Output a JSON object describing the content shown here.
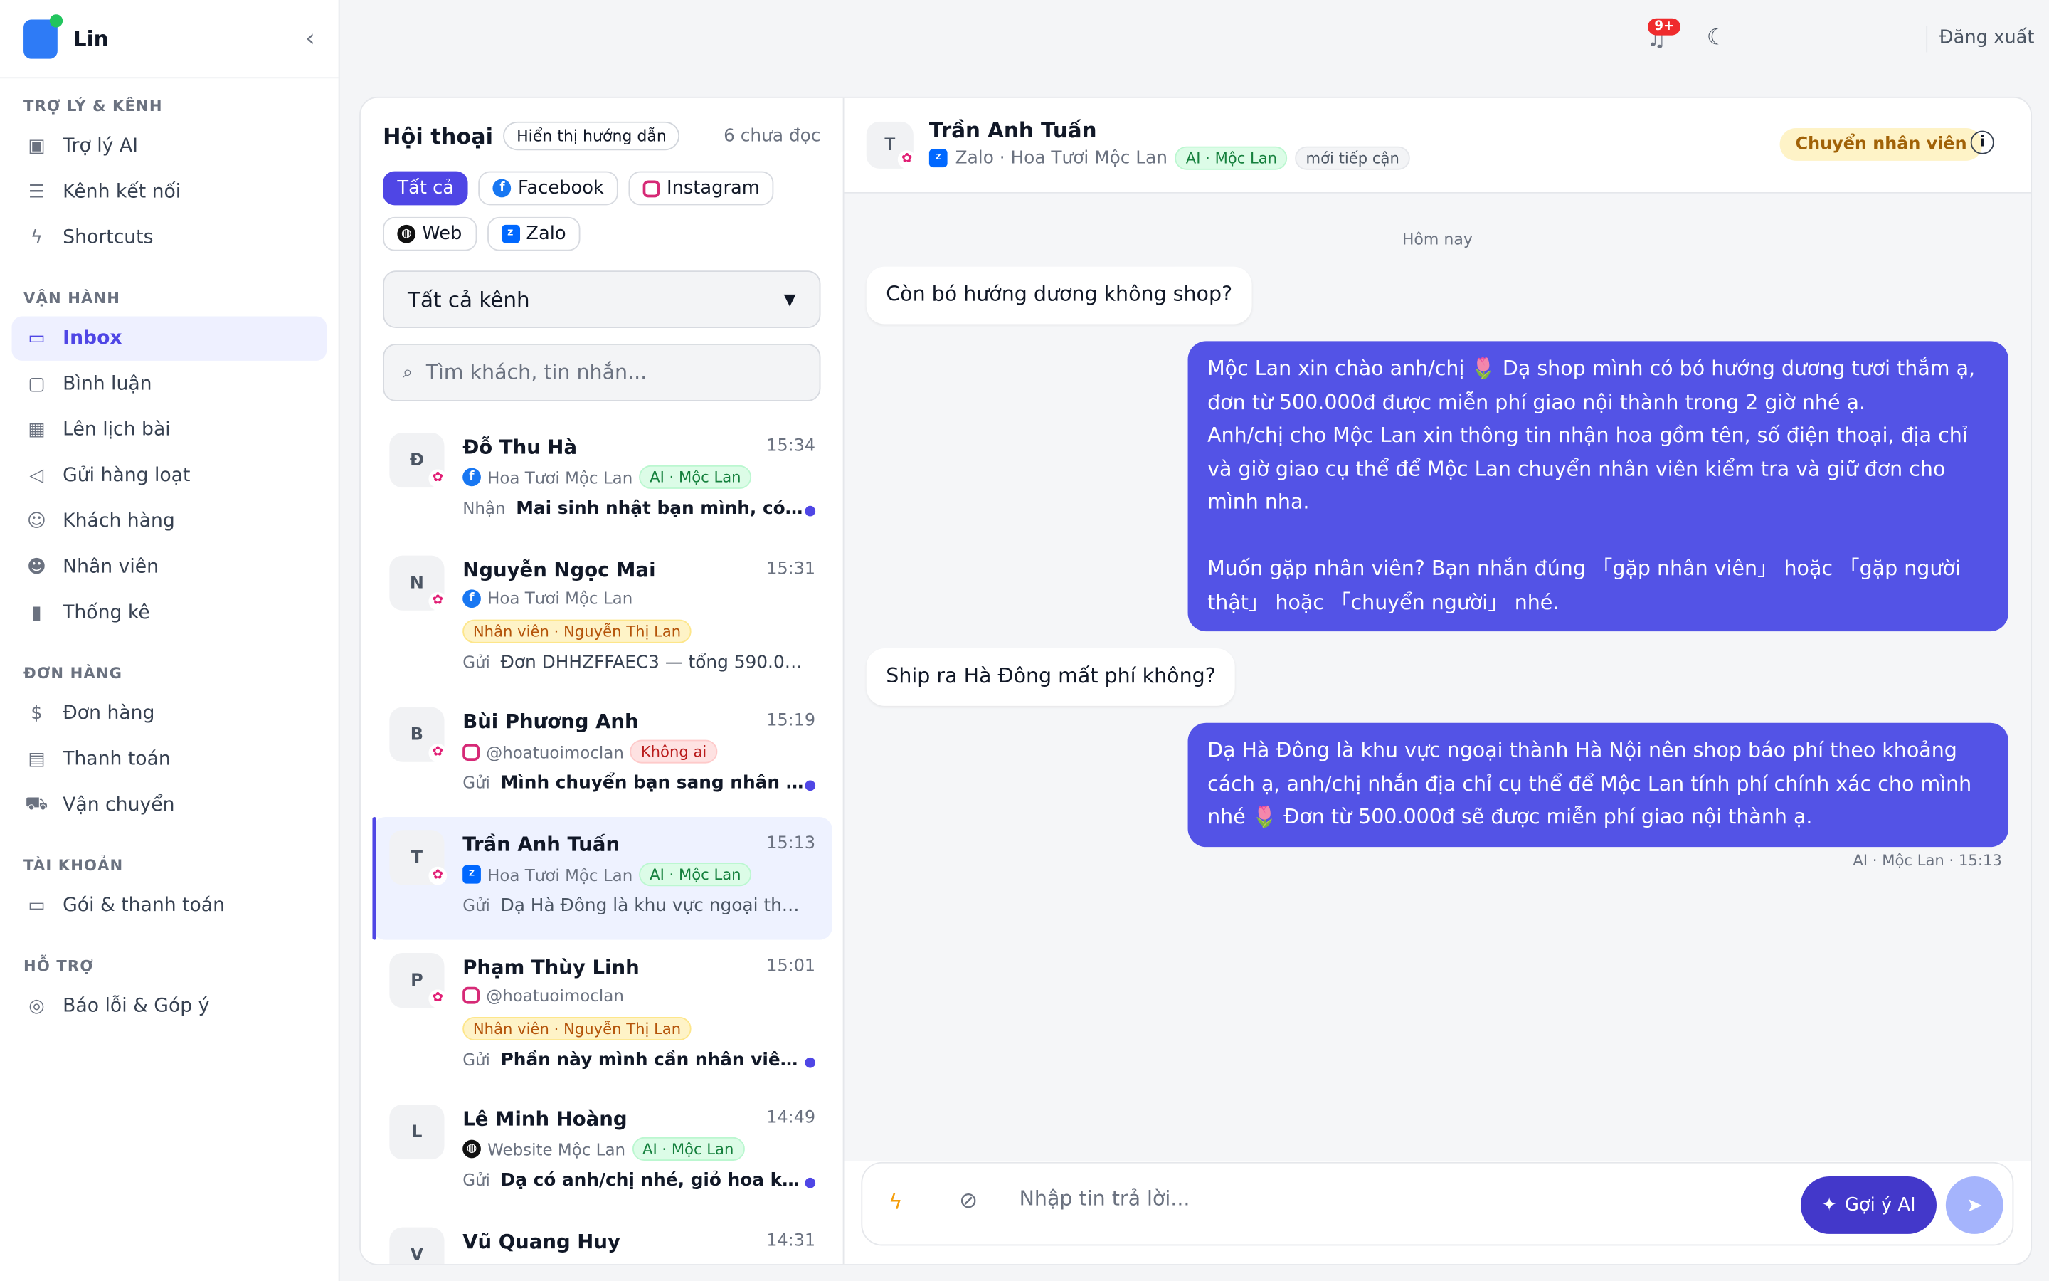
{
  "brand": {
    "name": "Lin"
  },
  "sidebar": {
    "sections": [
      {
        "title": "TRỢ LÝ & KÊNH",
        "items": [
          "Trợ lý AI",
          "Kênh kết nối",
          "Shortcuts"
        ]
      },
      {
        "title": "VẬN HÀNH",
        "items": [
          "Inbox",
          "Bình luận",
          "Lên lịch bài",
          "Gửi hàng loạt",
          "Khách hàng",
          "Nhân viên",
          "Thống kê"
        ]
      },
      {
        "title": "ĐƠN HÀNG",
        "items": [
          "Đơn hàng",
          "Thanh toán",
          "Vận chuyển"
        ]
      },
      {
        "title": "TÀI KHOẢN",
        "items": [
          "Gói & thanh toán"
        ]
      },
      {
        "title": "HỖ TRỢ",
        "items": [
          "Báo lỗi & Góp ý"
        ]
      }
    ]
  },
  "topbar": {
    "badge": "9+",
    "logout": "Đăng xuất"
  },
  "conv": {
    "title": "Hội thoại",
    "guide": "Hiển thị hướng dẫn",
    "unread": "6 chưa đọc",
    "chips": [
      "Tất cả",
      "Facebook",
      "Instagram",
      "Web",
      "Zalo"
    ],
    "select": "Tất cả kênh",
    "search_placeholder": "Tìm khách, tin nhắn...",
    "rows": [
      {
        "initial": "Đ",
        "name": "Đỗ Thu Hà",
        "time": "15:34",
        "channel": "Hoa Tươi Mộc Lan",
        "tag": "AI · Mộc Lan",
        "dir": "Nhận",
        "preview": "Mai sinh nhật bạn mình, có mẫ..."
      },
      {
        "initial": "N",
        "name": "Nguyễn Ngọc Mai",
        "time": "15:31",
        "channel": "Hoa Tươi Mộc Lan",
        "tag": "Nhân viên · Nguyễn Thị Lan",
        "dir": "Gửi",
        "preview": "Đơn DHHZFFAEC3 — tổng 590.00..."
      },
      {
        "initial": "B",
        "name": "Bùi Phương Anh",
        "time": "15:19",
        "channel": "@hoatuoimoclan",
        "tag": "Không ai",
        "dir": "Gửi",
        "preview": "Mình chuyển bạn sang nhân viên..."
      },
      {
        "initial": "T",
        "name": "Trần Anh Tuấn",
        "time": "15:13",
        "channel": "Hoa Tươi Mộc Lan",
        "tag": "AI · Mộc Lan",
        "dir": "Gửi",
        "preview": "Dạ Hà Đông là khu vực ngoại thành..."
      },
      {
        "initial": "P",
        "name": "Phạm Thùy Linh",
        "time": "15:01",
        "channel": "@hoatuoimoclan",
        "tag": "Nhân viên · Nguyễn Thị Lan",
        "dir": "Gửi",
        "preview": "Phần này mình cần nhân viên kiể..."
      },
      {
        "initial": "L",
        "name": "Lê Minh Hoàng",
        "time": "14:49",
        "channel": "Website Mộc Lan",
        "tag": "AI · Mộc Lan",
        "dir": "Gửi",
        "preview": "Dạ có anh/chị nhé, giỏ hoa khai ..."
      },
      {
        "initial": "V",
        "name": "Vũ Quang Huy",
        "time": "14:31"
      }
    ]
  },
  "chat": {
    "initial": "T",
    "name": "Trần Anh Tuấn",
    "channel": "Zalo · Hoa Tươi Mộc Lan",
    "tag_ai": "AI · Mộc Lan",
    "tag_new": "mới tiếp cận",
    "transfer": "Chuyển nhân viên",
    "day": "Hôm nay",
    "messages": [
      "Còn bó hướng dương không shop?",
      "Mộc Lan xin chào anh/chị 🌷 Dạ shop mình có bó hướng dương tươi thắm ạ, đơn từ 500.000đ được miễn phí giao nội thành trong 2 giờ nhé ạ.\nAnh/chị cho Mộc Lan xin thông tin nhận hoa gồm tên, số điện thoại, địa chỉ và giờ giao cụ thể để Mộc Lan chuyển nhân viên kiểm tra và giữ đơn cho mình nha.\n\nMuốn gặp nhân viên? Bạn nhắn đúng 「gặp nhân viên」 hoặc 「gặp người thật」 hoặc 「chuyển người」 nhé.",
      "Ship ra Hà Đông mất phí không?",
      "Dạ Hà Đông là khu vực ngoại thành Hà Nội nên shop báo phí theo khoảng cách ạ, anh/chị nhắn địa chỉ cụ thể để Mộc Lan tính phí chính xác cho mình nhé 🌷 Đơn từ 500.000đ sẽ được miễn phí giao nội thành ạ."
    ],
    "signature": "AI · Mộc Lan · 15:13",
    "composer_placeholder": "Nhập tin trả lời...",
    "ai_button": "Gợi ý AI"
  },
  "colors": {
    "accent": "#4f46e5",
    "bubble_out": "#5353e6"
  }
}
